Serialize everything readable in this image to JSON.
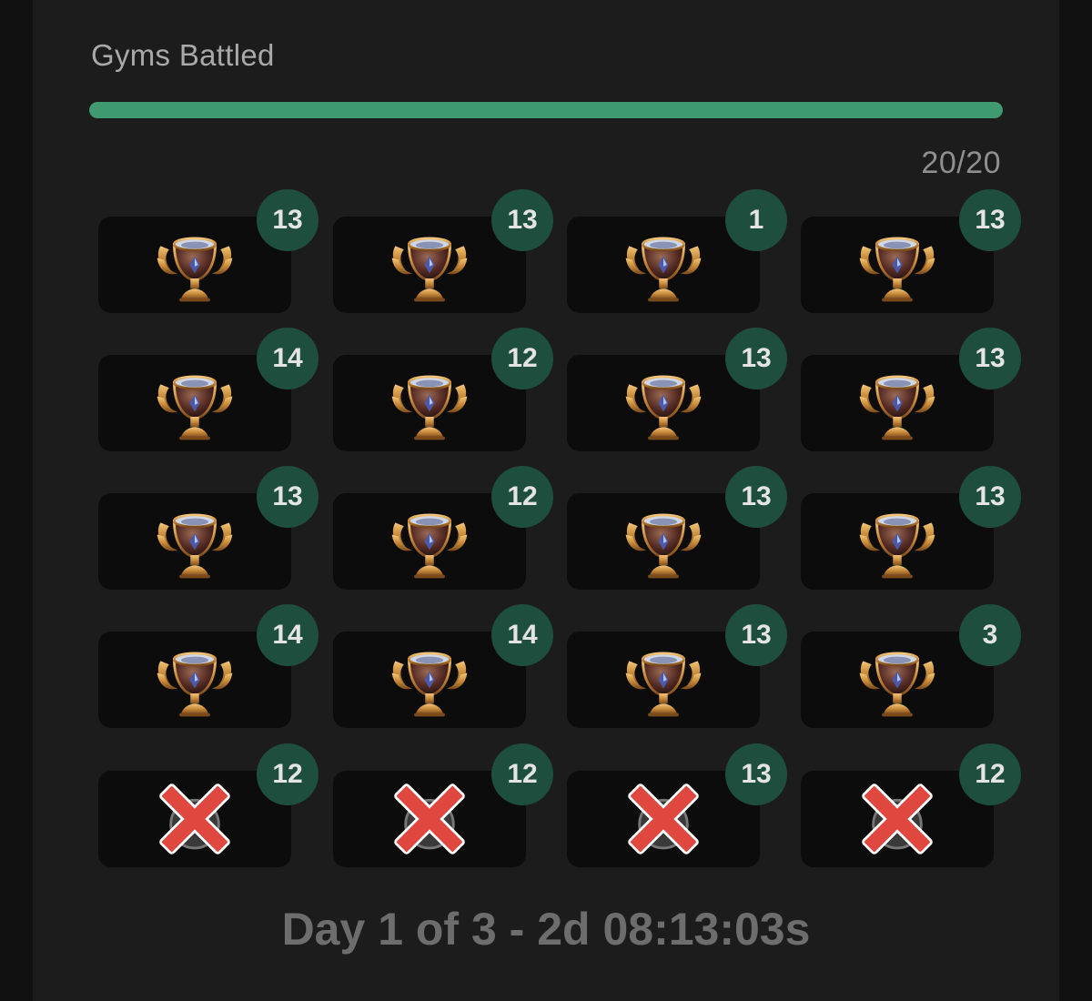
{
  "header": {
    "title": "Gyms Battled"
  },
  "progress": {
    "current": 20,
    "total": 20,
    "fraction": 1.0,
    "label": "20/20",
    "color": "#3f9a72"
  },
  "tiles": [
    {
      "status": "won",
      "badge": "13"
    },
    {
      "status": "won",
      "badge": "13"
    },
    {
      "status": "won",
      "badge": "1"
    },
    {
      "status": "won",
      "badge": "13"
    },
    {
      "status": "won",
      "badge": "14"
    },
    {
      "status": "won",
      "badge": "12"
    },
    {
      "status": "won",
      "badge": "13"
    },
    {
      "status": "won",
      "badge": "13"
    },
    {
      "status": "won",
      "badge": "13"
    },
    {
      "status": "won",
      "badge": "12"
    },
    {
      "status": "won",
      "badge": "13"
    },
    {
      "status": "won",
      "badge": "13"
    },
    {
      "status": "won",
      "badge": "14"
    },
    {
      "status": "won",
      "badge": "14"
    },
    {
      "status": "won",
      "badge": "13"
    },
    {
      "status": "won",
      "badge": "3"
    },
    {
      "status": "lost",
      "badge": "12"
    },
    {
      "status": "lost",
      "badge": "12"
    },
    {
      "status": "lost",
      "badge": "13"
    },
    {
      "status": "lost",
      "badge": "12"
    }
  ],
  "icons": {
    "won": "trophy-icon",
    "lost": "red-x-icon"
  },
  "footer": {
    "timer": "Day 1 of 3 - 2d 08:13:03s"
  }
}
